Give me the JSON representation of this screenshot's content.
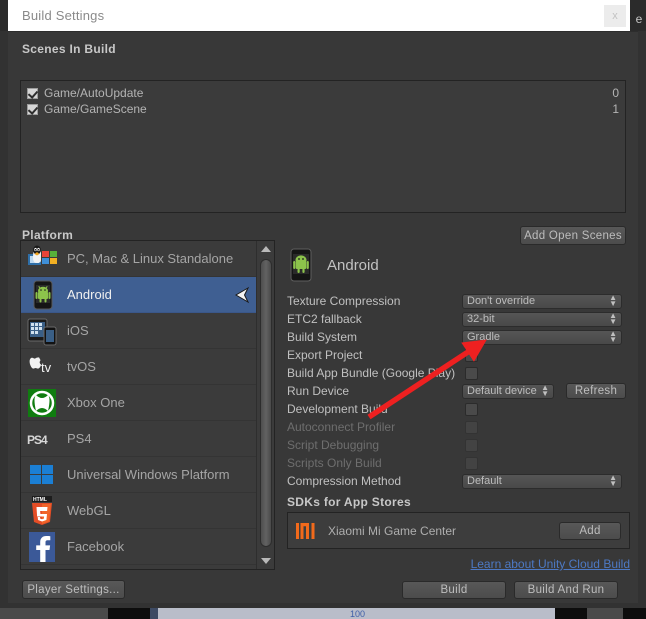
{
  "window": {
    "title": "Build Settings",
    "close_label": "x",
    "edge_letter": "e"
  },
  "scenes_section": {
    "header": "Scenes In Build",
    "scenes": [
      {
        "name": "Game/AutoUpdate",
        "index": "0",
        "enabled": true
      },
      {
        "name": "Game/GameScene",
        "index": "1",
        "enabled": true
      }
    ],
    "add_open_scenes_label": "Add Open Scenes"
  },
  "platform_section": {
    "header": "Platform",
    "items": [
      {
        "label": "PC, Mac & Linux Standalone",
        "icon": "standalone-icon",
        "selected": false
      },
      {
        "label": "Android",
        "icon": "android-icon",
        "selected": true,
        "unity_mark": true
      },
      {
        "label": "iOS",
        "icon": "ios-icon",
        "selected": false
      },
      {
        "label": "tvOS",
        "icon": "tvos-icon",
        "selected": false
      },
      {
        "label": "Xbox One",
        "icon": "xbox-icon",
        "selected": false
      },
      {
        "label": "PS4",
        "icon": "ps4-icon",
        "selected": false
      },
      {
        "label": "Universal Windows Platform",
        "icon": "windows-icon",
        "selected": false
      },
      {
        "label": "WebGL",
        "icon": "webgl-icon",
        "selected": false
      },
      {
        "label": "Facebook",
        "icon": "facebook-icon",
        "selected": false
      }
    ],
    "player_settings_label": "Player Settings..."
  },
  "build_settings": {
    "active_platform": "Android",
    "rows": [
      {
        "label": "Texture Compression",
        "type": "dropdown",
        "value": "Don't override",
        "disabled": false
      },
      {
        "label": "ETC2 fallback",
        "type": "dropdown",
        "value": "32-bit",
        "disabled": false
      },
      {
        "label": "Build System",
        "type": "dropdown",
        "value": "Gradle",
        "disabled": false
      },
      {
        "label": "Export Project",
        "type": "checkbox",
        "checked": false,
        "disabled": false
      },
      {
        "label": "Build App Bundle (Google Play)",
        "type": "checkbox",
        "checked": false,
        "disabled": false
      },
      {
        "label": "Run Device",
        "type": "dropdown-narrow",
        "value": "Default device",
        "button": "Refresh",
        "disabled": false
      },
      {
        "label": "Development Build",
        "type": "checkbox",
        "checked": false,
        "disabled": false
      },
      {
        "label": "Autoconnect Profiler",
        "type": "checkbox",
        "checked": false,
        "disabled": true
      },
      {
        "label": "Script Debugging",
        "type": "checkbox",
        "checked": false,
        "disabled": true
      },
      {
        "label": "Scripts Only Build",
        "type": "checkbox",
        "checked": false,
        "disabled": true
      },
      {
        "label": "Compression Method",
        "type": "dropdown",
        "value": "Default",
        "disabled": false
      }
    ]
  },
  "sdk_section": {
    "header": "SDKs for App Stores",
    "entry_name": "Xiaomi Mi Game Center",
    "add_label": "Add"
  },
  "footer": {
    "cloud_build_link": "Learn about Unity Cloud Build",
    "build_label": "Build",
    "build_and_run_label": "Build And Run"
  },
  "bottom_strip": {
    "number": "100"
  },
  "colors": {
    "accent_selected": "#3f5f92",
    "link": "#4d79c4",
    "annotation_arrow": "#ee2020",
    "panel_bg": "#383838",
    "list_bg": "#3b3b3b"
  }
}
